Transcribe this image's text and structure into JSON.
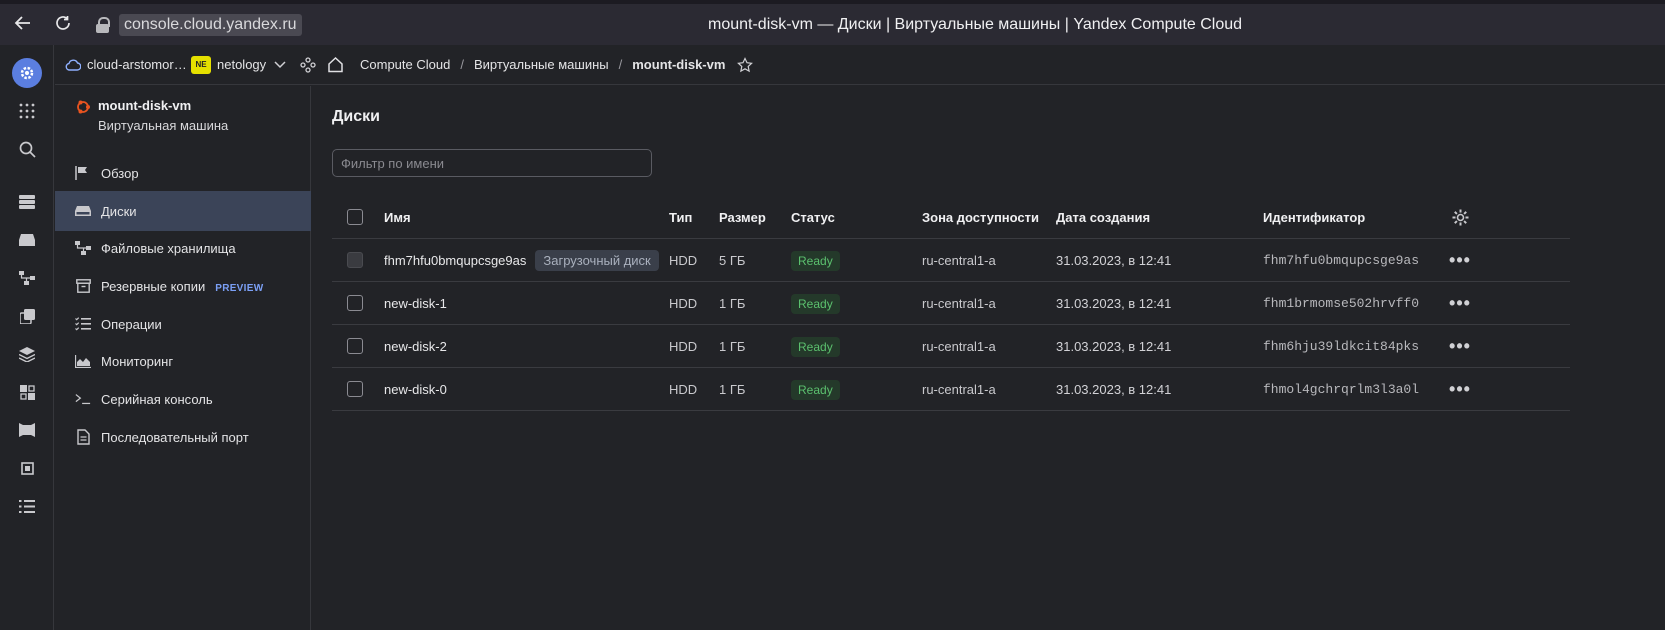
{
  "browser": {
    "url": "console.cloud.yandex.ru",
    "title": "mount-disk-vm — Диски | Виртуальные машины | Yandex Compute Cloud"
  },
  "topbar": {
    "cloud": "cloud-arstomor…",
    "folder_badge": "NE",
    "folder": "netology",
    "breadcrumbs": [
      "Compute Cloud",
      "Виртуальные машины",
      "mount-disk-vm"
    ]
  },
  "sidebar": {
    "vm_name": "mount-disk-vm",
    "vm_type": "Виртуальная машина",
    "items": [
      {
        "label": "Обзор",
        "icon": "flag-icon"
      },
      {
        "label": "Диски",
        "icon": "disk-icon"
      },
      {
        "label": "Файловые хранилища",
        "icon": "tree-icon"
      },
      {
        "label": "Резервные копии",
        "icon": "archive-icon",
        "badge": "PREVIEW"
      },
      {
        "label": "Операции",
        "icon": "list-check-icon"
      },
      {
        "label": "Мониторинг",
        "icon": "chart-area-icon"
      },
      {
        "label": "Серийная консоль",
        "icon": "terminal-icon"
      },
      {
        "label": "Последовательный порт",
        "icon": "file-icon"
      }
    ]
  },
  "main": {
    "title": "Диски",
    "filter_placeholder": "Фильтр по имени",
    "columns": [
      "Имя",
      "Тип",
      "Размер",
      "Статус",
      "Зона доступности",
      "Дата создания",
      "Идентификатор"
    ],
    "rows": [
      {
        "name": "fhm7hfu0bmqupcsge9as",
        "boot_badge": "Загрузочный диск",
        "type": "HDD",
        "size": "5 ГБ",
        "status": "Ready",
        "zone": "ru-central1-a",
        "created": "31.03.2023, в 12:41",
        "id": "fhm7hfu0bmqupcsge9as"
      },
      {
        "name": "new-disk-1",
        "type": "HDD",
        "size": "1 ГБ",
        "status": "Ready",
        "zone": "ru-central1-a",
        "created": "31.03.2023, в 12:41",
        "id": "fhm1brmomse502hrvff0"
      },
      {
        "name": "new-disk-2",
        "type": "HDD",
        "size": "1 ГБ",
        "status": "Ready",
        "zone": "ru-central1-a",
        "created": "31.03.2023, в 12:41",
        "id": "fhm6hju39ldkcit84pks"
      },
      {
        "name": "new-disk-0",
        "type": "HDD",
        "size": "1 ГБ",
        "status": "Ready",
        "zone": "ru-central1-a",
        "created": "31.03.2023, в 12:41",
        "id": "fhmol4gchrqrlm3l3a0l"
      }
    ],
    "row_action": "•••"
  },
  "colors": {
    "accent": "#5b7ee0",
    "active_bg": "#3b4458",
    "status_ready": "#5bc06e",
    "preview": "#7b9ff5",
    "folder_badge": "#e5e000"
  }
}
